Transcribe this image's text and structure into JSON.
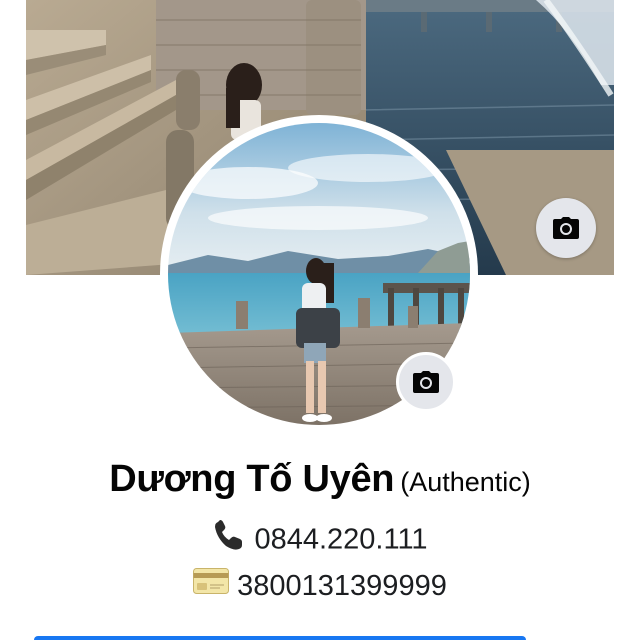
{
  "cover": {
    "photo_icon": "cover-photo-image",
    "camera_icon": "camera-icon"
  },
  "avatar": {
    "photo_icon": "profile-photo-image",
    "camera_icon": "camera-icon"
  },
  "profile": {
    "name": "Dương Tố Uyên",
    "name_suffix": "(Authentic)",
    "phone_icon": "telephone-receiver-icon",
    "phone": "0844.220.111",
    "card_icon": "credit-card-icon",
    "account_number": "3800131399999"
  },
  "colors": {
    "accent": "#1877f2",
    "camera_button_bg": "#e4e6eb",
    "text": "#050505"
  }
}
